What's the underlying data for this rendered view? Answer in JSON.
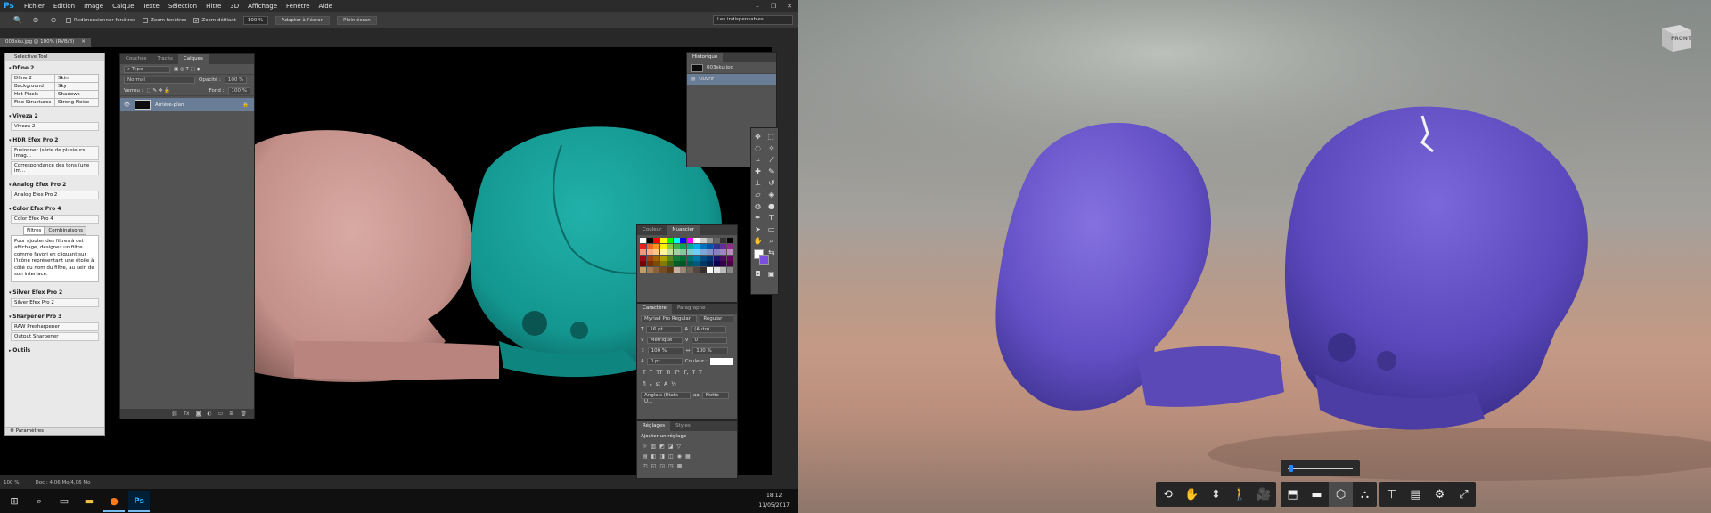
{
  "photoshop": {
    "logo": "Ps",
    "menu": [
      "Fichier",
      "Edition",
      "Image",
      "Calque",
      "Texte",
      "Sélection",
      "Filtre",
      "3D",
      "Affichage",
      "Fenêtre",
      "Aide"
    ],
    "options": {
      "resize_windows": "Redimensionner fenêtres",
      "zoom_windows": "Zoom fenêtres",
      "scrubby_zoom": "Zoom défilant",
      "zoom_value": "100 %",
      "fit_screen": "Adapter à l'écran",
      "full_screen": "Plein écran",
      "workspace": "Les indispensables"
    },
    "document_tab": "003sku.jpg @ 100% (RVB/8)",
    "selective_tool": {
      "title": "Selective Tool",
      "dfine": {
        "title": "Dfine 2",
        "items": [
          "Dfine 2",
          "Skin",
          "Background",
          "Sky",
          "Hot Pixels",
          "Shadows",
          "Fine Structures",
          "Strong Noise"
        ]
      },
      "viveza": {
        "title": "Viveza 2",
        "items": [
          "Viveza 2"
        ]
      },
      "hdr": {
        "title": "HDR Efex Pro 2",
        "items": [
          "Fusionner (série de plusieurs imag...",
          "Correspondance des tons (une im..."
        ]
      },
      "analog": {
        "title": "Analog Efex Pro 2",
        "items": [
          "Analog Efex Pro 2"
        ]
      },
      "color": {
        "title": "Color Efex Pro 4",
        "items": [
          "Color Efex Pro 4"
        ]
      },
      "tabs": [
        "Filtres",
        "Combinaisons"
      ],
      "description": "Pour ajouter des filtres à cet affichage, désignez un filtre comme favori en cliquant sur l'icône représentant une étoile à côté du nom du filtre, au sein de son interface.",
      "silver": {
        "title": "Silver Efex Pro 2",
        "items": [
          "Silver Efex Pro 2"
        ]
      },
      "sharpener": {
        "title": "Sharpener Pro 3",
        "items": [
          "RAW Presharpener",
          "Output Sharpener"
        ]
      },
      "outils": "Outils",
      "params": "Paramètres"
    },
    "layers": {
      "tabs": [
        "Couches",
        "Tracés",
        "Calques"
      ],
      "kind": "Type",
      "mode": "Normal",
      "opacity_label": "Opacité :",
      "opacity": "100 %",
      "lock_label": "Verrou :",
      "fill_label": "Fond :",
      "fill": "100 %",
      "layer_name": "Arrière-plan"
    },
    "history": {
      "title": "Historique",
      "items": [
        "003sku.jpg",
        "Ouvrir"
      ]
    },
    "swatches": {
      "tabs": [
        "Couleur",
        "Nuancier"
      ],
      "colors": [
        "#ffffff",
        "#000000",
        "#ff0000",
        "#ffff00",
        "#00ff00",
        "#00ffff",
        "#0000ff",
        "#ff00ff",
        "#ffffff",
        "#cccccc",
        "#999999",
        "#666666",
        "#333333",
        "#000000",
        "#ee1d24",
        "#f26522",
        "#f7941d",
        "#fff200",
        "#8dc63f",
        "#39b54a",
        "#00a651",
        "#00a99d",
        "#00aeef",
        "#0072bc",
        "#0054a6",
        "#2e3192",
        "#662d91",
        "#92278f",
        "#f69679",
        "#f9ad81",
        "#fdc689",
        "#fff799",
        "#c4df9b",
        "#a3d39c",
        "#82ca9d",
        "#7accc8",
        "#6dcff6",
        "#7da7d9",
        "#8393ca",
        "#8781bd",
        "#a186be",
        "#bd8cbf",
        "#9e0b0f",
        "#a0410d",
        "#a36209",
        "#aba000",
        "#598527",
        "#1a7b30",
        "#007236",
        "#00746b",
        "#0076a3",
        "#004b80",
        "#003471",
        "#1b1464",
        "#440e62",
        "#630460",
        "#790000",
        "#7b2e00",
        "#7d4900",
        "#827b00",
        "#406618",
        "#005e20",
        "#005826",
        "#005952",
        "#005b7f",
        "#003663",
        "#002157",
        "#0d004c",
        "#32004b",
        "#4b0049",
        "#c69c6d",
        "#a67c52",
        "#8c6239",
        "#754c24",
        "#603913",
        "#c7b299",
        "#998675",
        "#736357",
        "#534741",
        "#362f2d",
        "#ffffff",
        "#e6e6e6",
        "#bbbbbb",
        "#888888"
      ]
    },
    "character": {
      "tabs": [
        "Caractère",
        "Paragraphe"
      ],
      "font_family": "Myriad Pro Regular",
      "font_style": "Regular",
      "font_size": "16 pt",
      "leading": "(Auto)",
      "kerning": "Métrique",
      "tracking": "0",
      "vscale": "100 %",
      "hscale": "100 %",
      "baseline": "0 pt",
      "color_label": "Couleur :",
      "type_buttons": [
        "T",
        "T",
        "TT",
        "Tr",
        "T¹",
        "T,",
        "T",
        "T"
      ],
      "language": "Anglais (Etats-U...",
      "aa": "Nette"
    },
    "adjustments": {
      "tabs": [
        "Réglages",
        "Styles"
      ],
      "add_label": "Ajouter un réglage"
    },
    "status": {
      "zoom": "100 %",
      "doc": "Doc : 4,06 Mo/4,06 Mo"
    },
    "clock": {
      "time": "18:12",
      "date": "11/05/2017"
    }
  },
  "viewer": {
    "viewcube_label": "FRONT",
    "slider_value": 0.05,
    "colors": {
      "skull_left": "#6a55c8",
      "skull_right": "#5f4ec0",
      "toolbar": "#252525",
      "slider_thumb": "#1f8bff"
    }
  },
  "colors": {
    "ps_bg": "#282828",
    "panel": "#535353",
    "selected": "#6a7d96",
    "ps_accent": "#31a8ff",
    "skull_pink": "#c99891",
    "skull_teal": "#159c96"
  }
}
